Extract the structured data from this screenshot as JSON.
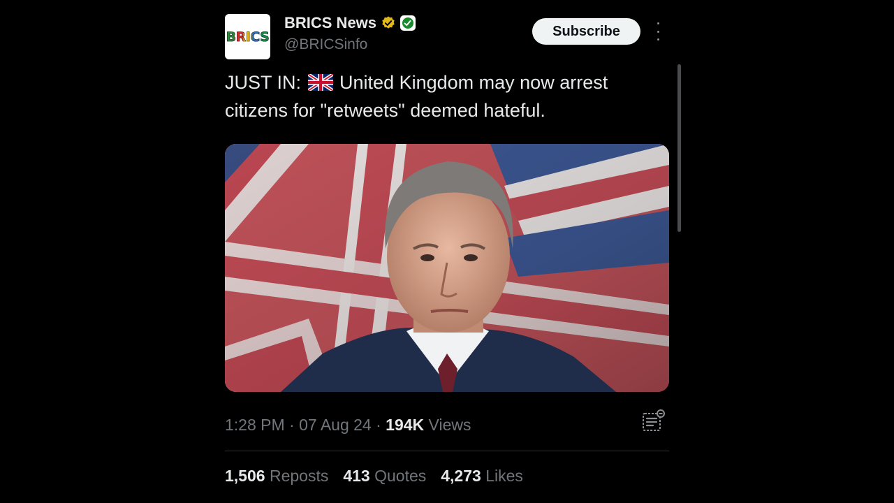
{
  "account": {
    "avatar_text": "BRICS",
    "name": "BRICS News",
    "handle": "@BRICSinfo",
    "verified_badge_icon": "gold-verified-badge-icon",
    "affiliate_icon": "affiliate-badge-icon"
  },
  "actions": {
    "subscribe_label": "Subscribe",
    "more_icon": "vertical-ellipsis-icon"
  },
  "post": {
    "prefix": "JUST IN:",
    "flag_icon": "uk-flag-emoji-icon",
    "text": "United Kingdom may now arrest citizens for \"retweets\" deemed hateful."
  },
  "media": {
    "description": "photo of a man in a suit in front of a Union Jack flag"
  },
  "meta": {
    "time": "1:28 PM",
    "separator": "·",
    "date": "07 Aug 24",
    "views_count": "194K",
    "views_label": "Views",
    "analytics_icon": "post-analytics-icon"
  },
  "stats": {
    "reposts_count": "1,506",
    "reposts_label": "Reposts",
    "quotes_count": "413",
    "quotes_label": "Quotes",
    "likes_count": "4,273",
    "likes_label": "Likes"
  },
  "colors": {
    "background": "#000000",
    "primary_text": "#e7e9ea",
    "secondary_text": "#71767b",
    "verified_gold": "#e2b719",
    "affiliate_green": "#1a8a2e"
  }
}
